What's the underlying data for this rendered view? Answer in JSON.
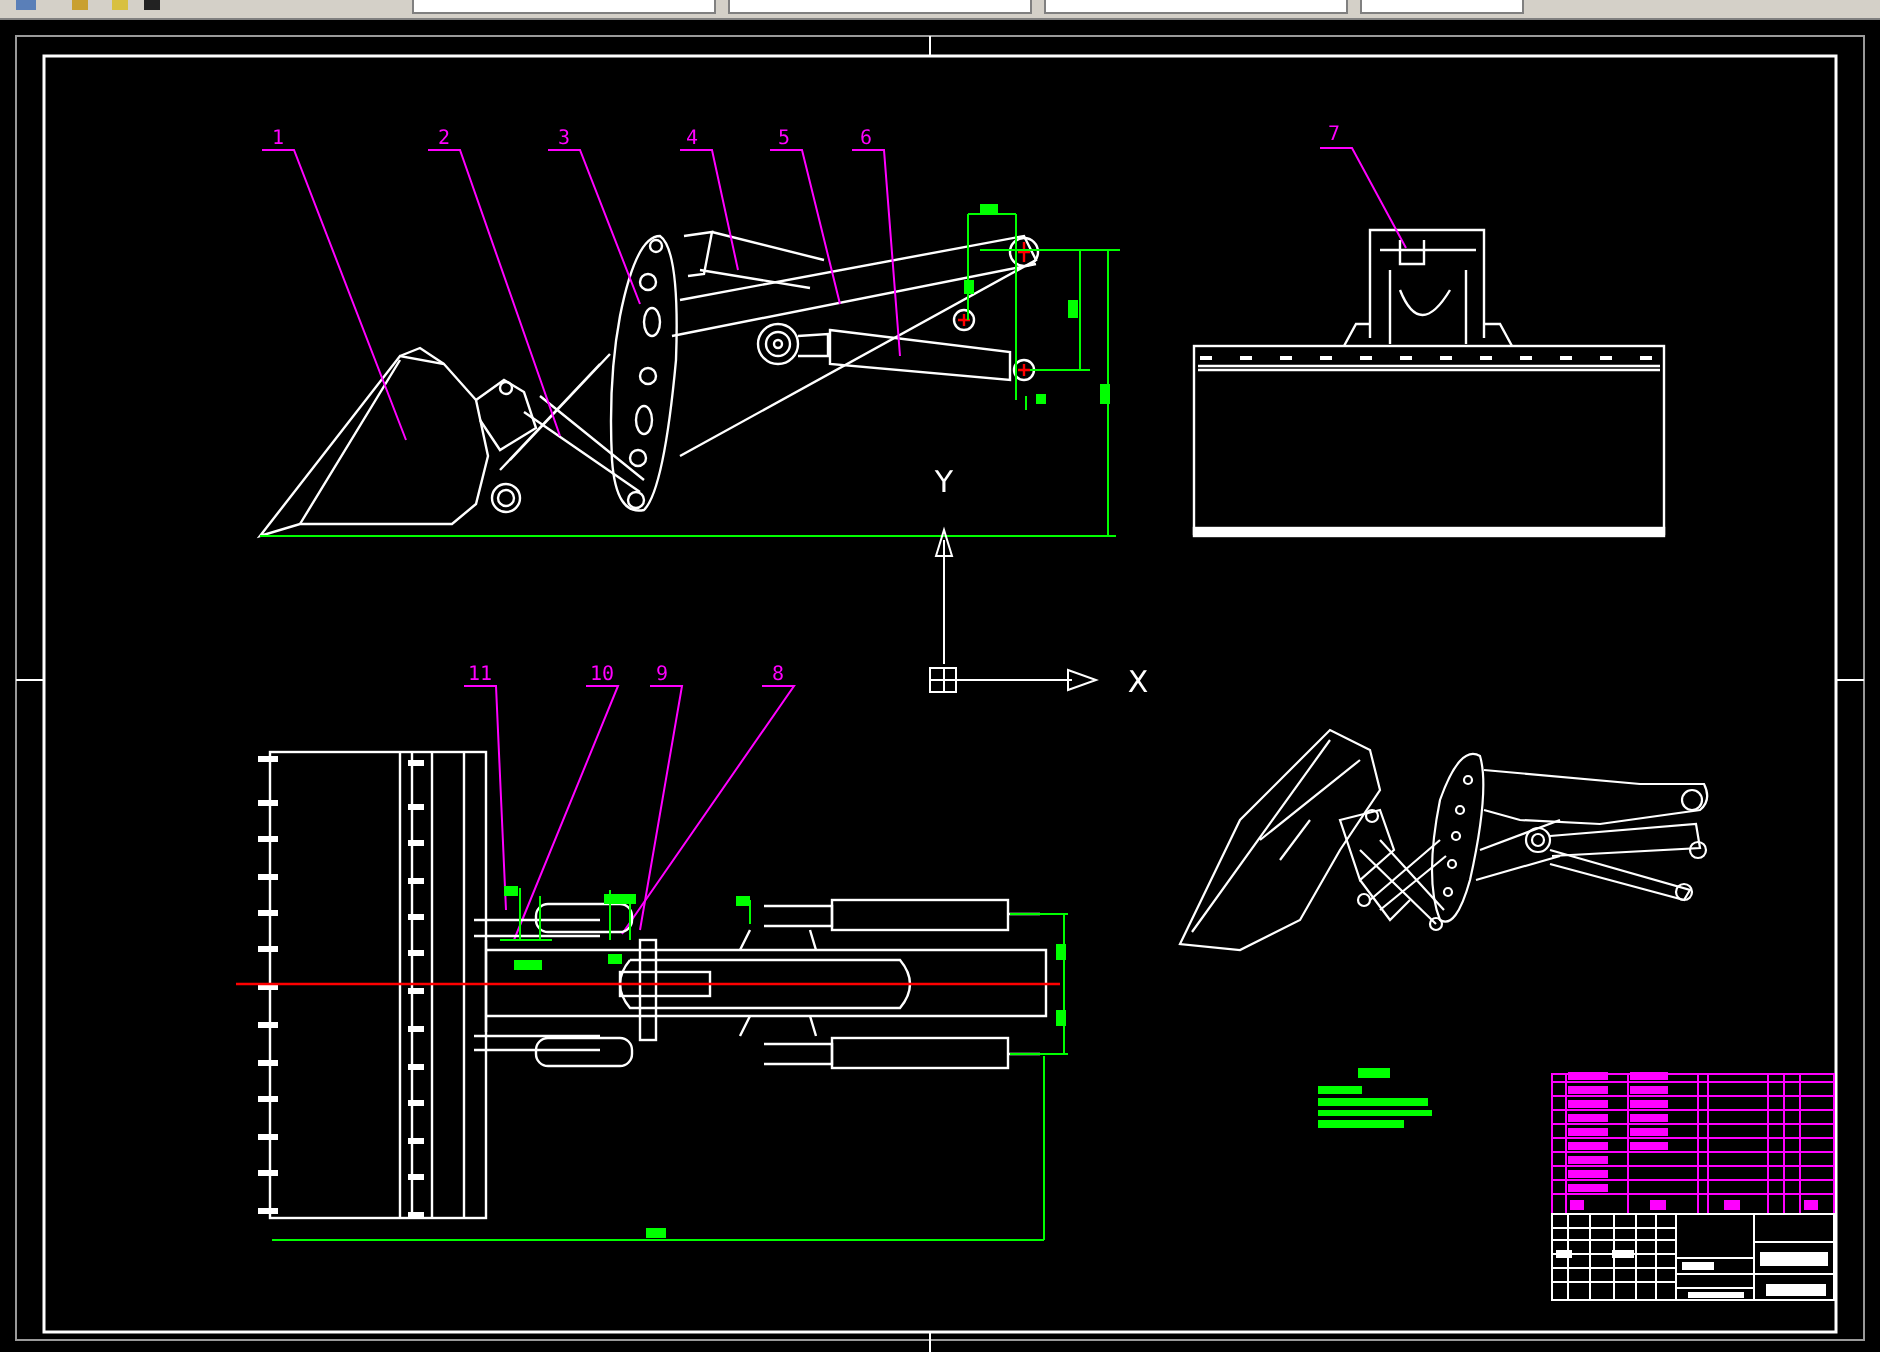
{
  "balloons": [
    {
      "label": "1"
    },
    {
      "label": "2"
    },
    {
      "label": "3"
    },
    {
      "label": "4"
    },
    {
      "label": "5"
    },
    {
      "label": "6"
    },
    {
      "label": "7"
    },
    {
      "label": "11"
    },
    {
      "label": "10"
    },
    {
      "label": "9"
    },
    {
      "label": "8"
    }
  ],
  "axes": {
    "y_label": "Y",
    "x_label": "X"
  }
}
